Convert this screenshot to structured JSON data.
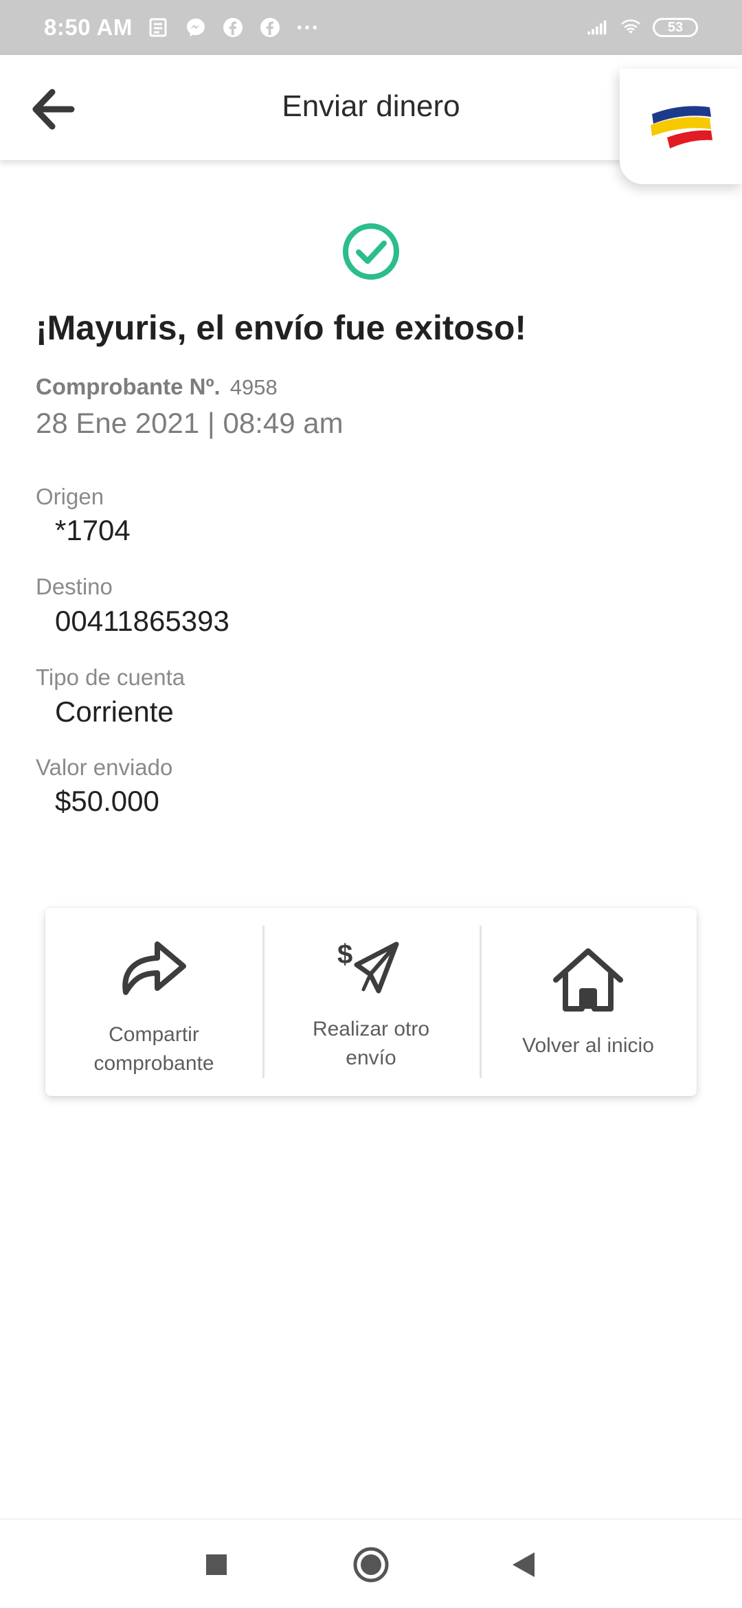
{
  "status_bar": {
    "time": "8:50 AM",
    "battery": "53",
    "icons": [
      "news-icon",
      "messenger-icon",
      "facebook-icon",
      "facebook-icon",
      "more-dots-icon",
      "signal-icon",
      "wifi-icon",
      "battery-icon"
    ]
  },
  "header": {
    "title": "Enviar dinero",
    "back_icon": "arrow-left-icon",
    "brand_colors": [
      "#1c3a8c",
      "#f6c900",
      "#e11b22"
    ]
  },
  "result": {
    "title": "¡Mayuris, el envío fue exitoso!",
    "receipt_label": "Comprobante Nº.",
    "receipt_number": "4958",
    "datetime": "28 Ene 2021 | 08:49 am",
    "check_color": "#2bbd8a"
  },
  "details": {
    "origen_label": "Origen",
    "origen_value": "*1704",
    "destino_label": "Destino",
    "destino_value": "00411865393",
    "tipo_label": "Tipo de cuenta",
    "tipo_value": "Corriente",
    "valor_label": "Valor enviado",
    "valor_value": "$50.000"
  },
  "actions": {
    "share_line1": "Compartir",
    "share_line2": "comprobante",
    "another_line1": "Realizar otro",
    "another_line2": "envío",
    "home_label": "Volver al inicio"
  },
  "nav": {
    "icons": [
      "recents-square-icon",
      "home-circle-icon",
      "back-triangle-icon"
    ]
  }
}
